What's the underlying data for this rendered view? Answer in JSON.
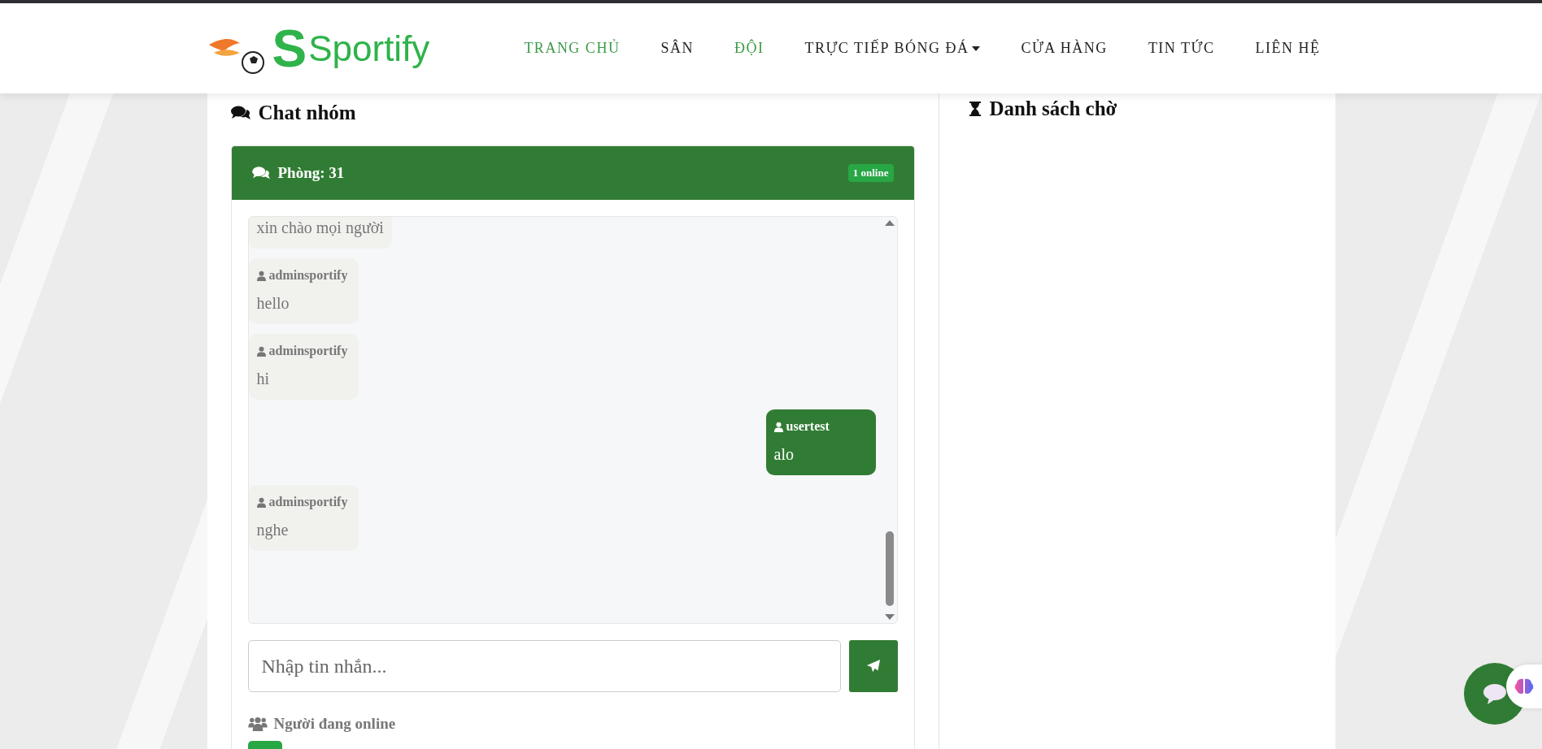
{
  "brand": {
    "initial": "S",
    "name": "Sportify"
  },
  "nav": [
    {
      "label": "TRANG CHỦ",
      "selected": true,
      "dropdown": false
    },
    {
      "label": "SÂN",
      "selected": false,
      "dropdown": false
    },
    {
      "label": "ĐỘI",
      "selected": true,
      "dropdown": false
    },
    {
      "label": "TRỰC TIẾP BÓNG ĐÁ",
      "selected": false,
      "dropdown": true
    },
    {
      "label": "CỬA HÀNG",
      "selected": false,
      "dropdown": false
    },
    {
      "label": "TIN TỨC",
      "selected": false,
      "dropdown": false
    },
    {
      "label": "LIÊN HỆ",
      "selected": false,
      "dropdown": false
    }
  ],
  "chat": {
    "title": "Chat nhóm",
    "room": "Phòng: 31",
    "online_badge": "1 online",
    "messages": [
      {
        "text": "xin chào mọi người",
        "mine": false
      },
      {
        "sender": "adminsportify",
        "text": "hello",
        "mine": false
      },
      {
        "sender": "adminsportify",
        "text": "hi",
        "mine": false
      },
      {
        "sender": "usertest",
        "text": "alo",
        "mine": true
      },
      {
        "sender": "adminsportify",
        "text": "nghe",
        "mine": false
      }
    ],
    "input": {
      "placeholder": "Nhập tin nhắn..."
    },
    "online_title": "Người đang online"
  },
  "waiting": {
    "title": "Danh sách chờ"
  }
}
